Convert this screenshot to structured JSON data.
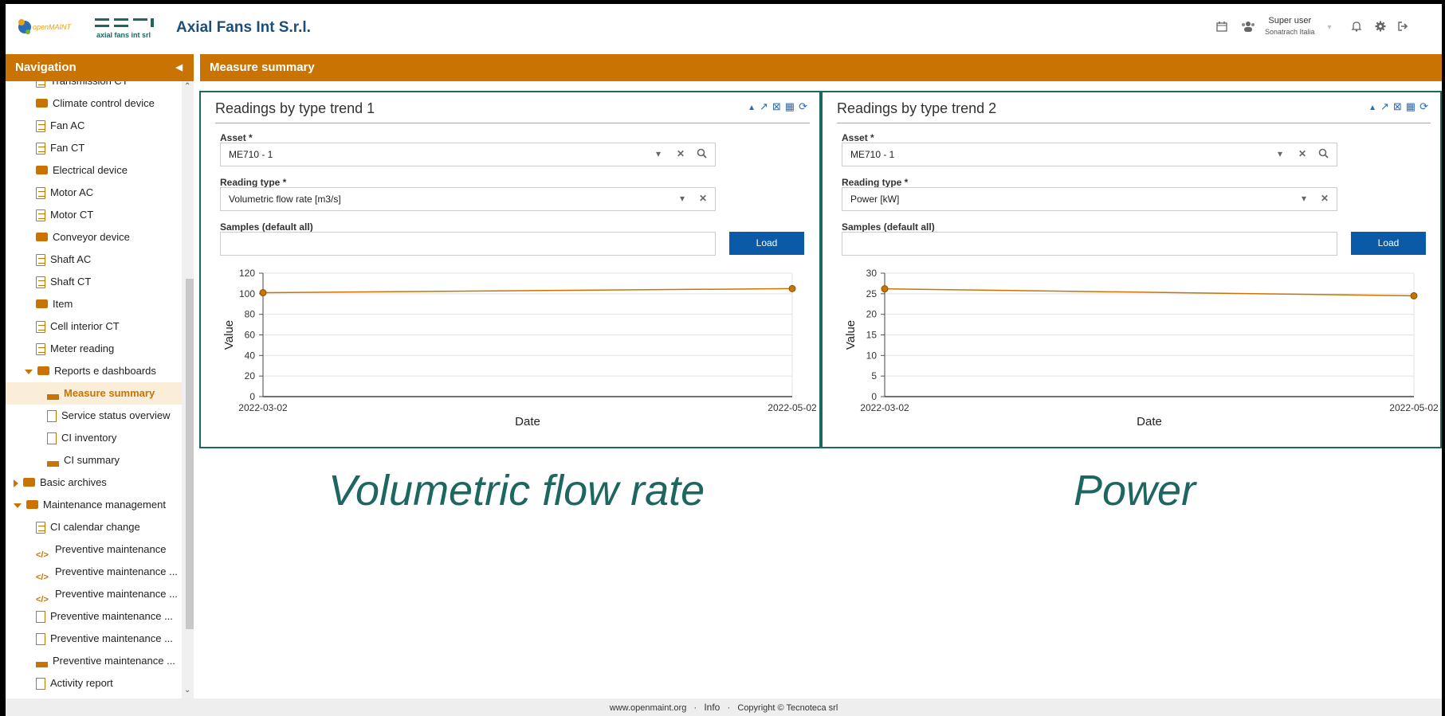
{
  "header": {
    "company_name": "Axial Fans Int S.r.l.",
    "logo_openmaint": "openMAINT",
    "logo_afi_text": "axial fans int srl",
    "user_name": "Super user",
    "user_org": "Sonatrach Italia",
    "icons": [
      "calendar-icon",
      "users-icon",
      "bell-icon",
      "gear-icon",
      "logout-icon"
    ]
  },
  "nav": {
    "title": "Navigation",
    "items": [
      {
        "label": "Transmission CT",
        "icon": "doc",
        "level": 2
      },
      {
        "label": "Climate control device",
        "icon": "folder",
        "level": 2
      },
      {
        "label": "Fan AC",
        "icon": "doc",
        "level": 2
      },
      {
        "label": "Fan CT",
        "icon": "doc",
        "level": 2
      },
      {
        "label": "Electrical device",
        "icon": "folder",
        "level": 2
      },
      {
        "label": "Motor AC",
        "icon": "doc",
        "level": 2
      },
      {
        "label": "Motor CT",
        "icon": "doc",
        "level": 2
      },
      {
        "label": "Conveyor device",
        "icon": "folder",
        "level": 2
      },
      {
        "label": "Shaft AC",
        "icon": "doc",
        "level": 2
      },
      {
        "label": "Shaft CT",
        "icon": "doc",
        "level": 2
      },
      {
        "label": "Item",
        "icon": "folder",
        "level": 2
      },
      {
        "label": "Cell interior CT",
        "icon": "doc",
        "level": 2
      },
      {
        "label": "Meter reading",
        "icon": "doc",
        "level": 2
      },
      {
        "label": "Reports e dashboards",
        "icon": "folder-open",
        "level": 1
      },
      {
        "label": "Measure summary",
        "icon": "chart",
        "level": 3,
        "selected": true
      },
      {
        "label": "Service status overview",
        "icon": "pdf",
        "level": 3
      },
      {
        "label": "CI inventory",
        "icon": "pdf",
        "level": 3
      },
      {
        "label": "CI summary",
        "icon": "chart",
        "level": 3
      },
      {
        "label": "Basic archives",
        "icon": "folder-closed",
        "level": 0
      },
      {
        "label": "Maintenance management",
        "icon": "folder-open",
        "level": 0
      },
      {
        "label": "CI calendar change",
        "icon": "doc",
        "level": 2
      },
      {
        "label": "Preventive maintenance",
        "icon": "code",
        "level": 2
      },
      {
        "label": "Preventive maintenance ...",
        "icon": "code",
        "level": 2
      },
      {
        "label": "Preventive maintenance ...",
        "icon": "code",
        "level": 2
      },
      {
        "label": "Preventive maintenance ...",
        "icon": "pdf",
        "level": 2
      },
      {
        "label": "Preventive maintenance ...",
        "icon": "pdf",
        "level": 2
      },
      {
        "label": "Preventive maintenance ...",
        "icon": "chart",
        "level": 2
      },
      {
        "label": "Activity report",
        "icon": "pdf",
        "level": 2
      }
    ]
  },
  "main": {
    "title": "Measure summary",
    "panels": [
      {
        "title": "Readings by type trend 1",
        "asset_label": "Asset *",
        "asset_value": "ME710 - 1",
        "reading_type_label": "Reading type *",
        "reading_type_value": "Volumetric flow rate [m3/s]",
        "samples_label": "Samples (default all)",
        "samples_value": "",
        "load_label": "Load",
        "caption": "Volumetric flow rate"
      },
      {
        "title": "Readings by type trend 2",
        "asset_label": "Asset *",
        "asset_value": "ME710 - 1",
        "reading_type_label": "Reading type *",
        "reading_type_value": "Power [kW]",
        "samples_label": "Samples (default all)",
        "samples_value": "",
        "load_label": "Load",
        "caption": "Power"
      }
    ]
  },
  "chart_data": [
    {
      "type": "line",
      "x": [
        "2022-03-02",
        "2022-05-02"
      ],
      "series": [
        {
          "values": [
            101,
            105
          ]
        }
      ],
      "xlabel": "Date",
      "ylabel": "Value",
      "ylim": [
        0,
        120
      ],
      "yticks": [
        0,
        20,
        40,
        60,
        80,
        100,
        120
      ],
      "grid": true,
      "color": "#c97402"
    },
    {
      "type": "line",
      "x": [
        "2022-03-02",
        "2022-05-02"
      ],
      "series": [
        {
          "values": [
            26.2,
            24.5
          ]
        }
      ],
      "xlabel": "Date",
      "ylabel": "Value",
      "ylim": [
        0,
        30
      ],
      "yticks": [
        0,
        5,
        10,
        15,
        20,
        25,
        30
      ],
      "grid": true,
      "color": "#c97402"
    }
  ],
  "footer": {
    "site": "www.openmaint.org",
    "sep": "·",
    "info": "Info",
    "copyright": "Copyright © Tecnoteca srl"
  }
}
